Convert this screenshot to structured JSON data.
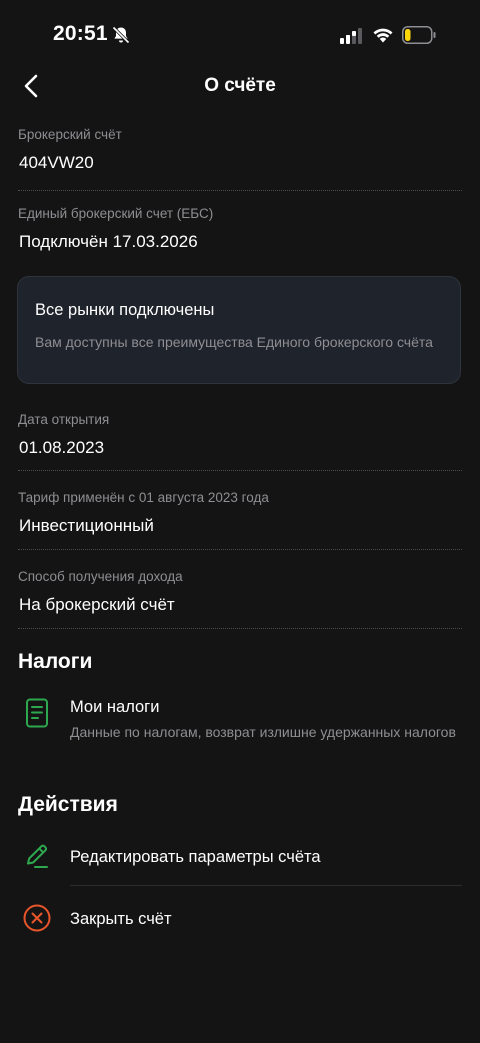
{
  "status_bar": {
    "time": "20:51"
  },
  "header": {
    "title": "О счёте"
  },
  "info": {
    "account_label": "Брокерский счёт",
    "account_value": "404VW20",
    "ebs_label": "Единый брокерский счет (ЕБС)",
    "ebs_value": "Подключён 17.03.2026",
    "open_date_label": "Дата открытия",
    "open_date_value": "01.08.2023",
    "tariff_label": "Тариф применён с 01 августа 2023 года",
    "tariff_value": "Инвестиционный",
    "income_label": "Способ получения дохода",
    "income_value": "На брокерский счёт"
  },
  "card": {
    "title": "Все рынки подключены",
    "description": "Вам доступны все преимущества Единого брокерского счёта"
  },
  "taxes": {
    "section_title": "Налоги",
    "item_title": "Мои налоги",
    "item_description": "Данные по налогам, возврат излишне удержанных налогов"
  },
  "actions": {
    "section_title": "Действия",
    "edit_label": "Редактировать параметры счёта",
    "close_label": "Закрыть счёт"
  },
  "colors": {
    "background": "#141414",
    "card_background": "#1f232b",
    "secondary_text": "#8e8e93",
    "accent_green": "#2ea84f",
    "danger_orange": "#e8552b",
    "battery_level": "#ffd60a"
  },
  "icons": {
    "back": "chevron-left-icon",
    "bell": "bell-slash-icon",
    "signal": "cellular-signal-icon",
    "wifi": "wifi-icon",
    "battery": "battery-low-icon",
    "taxes": "document-icon",
    "edit": "pencil-icon",
    "close": "close-circle-icon"
  }
}
